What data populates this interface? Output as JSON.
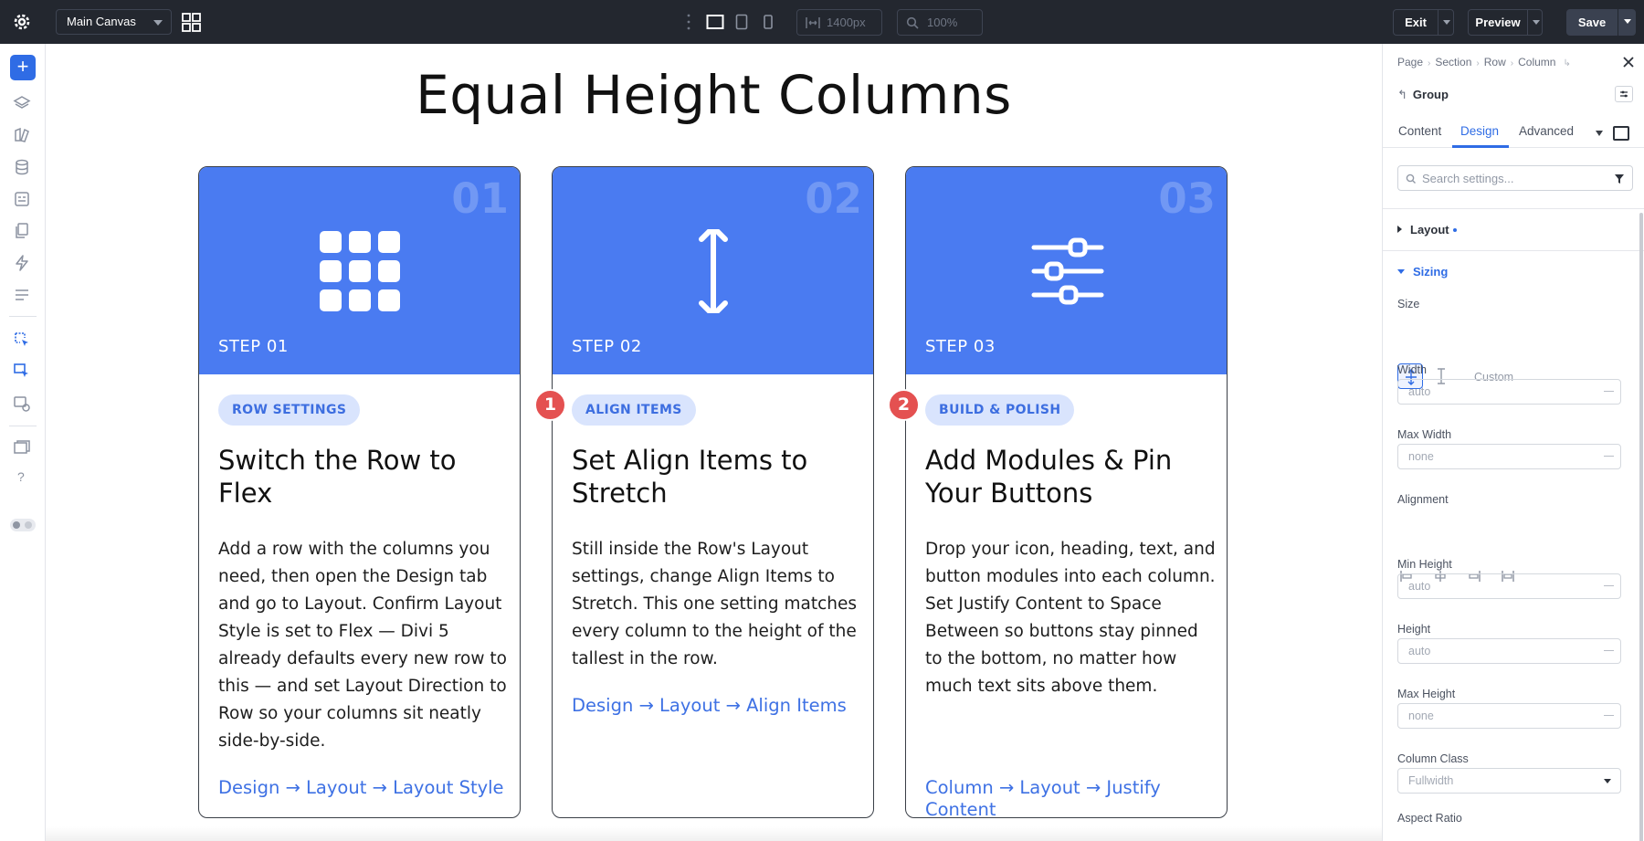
{
  "topbar": {
    "canvas_select": "Main Canvas",
    "width_value": "1400px",
    "zoom_value": "100%",
    "exit_label": "Exit",
    "preview_label": "Preview",
    "save_label": "Save"
  },
  "canvas": {
    "page_title": "Equal Height Columns",
    "cards": [
      {
        "number": "01",
        "step_label": "STEP 01",
        "pill": "ROW SETTINGS",
        "heading": "Switch the Row to Flex",
        "body": "Add a row with the columns you need, then open the Design tab and go to Layout. Confirm Layout Style is set to Flex — Divi 5 already defaults every new row to this — and set Layout Direction to Row so your columns sit neatly side-by-side.",
        "link": "Design → Layout → Layout Style",
        "icon": "grid-icon"
      },
      {
        "number": "02",
        "step_label": "STEP 02",
        "pill": "ALIGN ITEMS",
        "heading": "Set Align Items to Stretch",
        "body": "Still inside the Row's Layout settings, change Align Items to Stretch. This one setting matches every column to the height of the tallest in the row.",
        "link": "Design → Layout → Align Items",
        "icon": "vertical-arrows-icon",
        "marker": "1"
      },
      {
        "number": "03",
        "step_label": "STEP 03",
        "pill": "BUILD & POLISH",
        "heading": "Add Modules & Pin Your Buttons",
        "body": "Drop your icon, heading, text, and button modules into each column. Set Justify Content to Space Between so buttons stay pinned to the bottom, no matter how much text sits above them.",
        "link": "Column → Layout → Justify Content",
        "icon": "sliders-icon",
        "marker": "2"
      }
    ]
  },
  "panel": {
    "breadcrumb": [
      "Page",
      "Section",
      "Row",
      "Column"
    ],
    "group_label": "Group",
    "tabs": [
      "Content",
      "Design",
      "Advanced"
    ],
    "active_tab": "Design",
    "search_placeholder": "Search settings...",
    "sections": {
      "layout": "Layout",
      "sizing": "Sizing"
    },
    "fields": {
      "size_label": "Size",
      "size_custom": "Custom",
      "width_label": "Width",
      "width_value": "auto",
      "max_width_label": "Max Width",
      "max_width_value": "none",
      "alignment_label": "Alignment",
      "min_height_label": "Min Height",
      "min_height_value": "auto",
      "height_label": "Height",
      "height_value": "auto",
      "max_height_label": "Max Height",
      "max_height_value": "none",
      "column_class_label": "Column Class",
      "column_class_value": "Fullwidth",
      "aspect_ratio_label": "Aspect Ratio"
    }
  },
  "colors": {
    "accent": "#2f6ce5",
    "card_blue": "#4a7bf1",
    "marker_red": "#e45151",
    "topbar": "#23272f"
  }
}
